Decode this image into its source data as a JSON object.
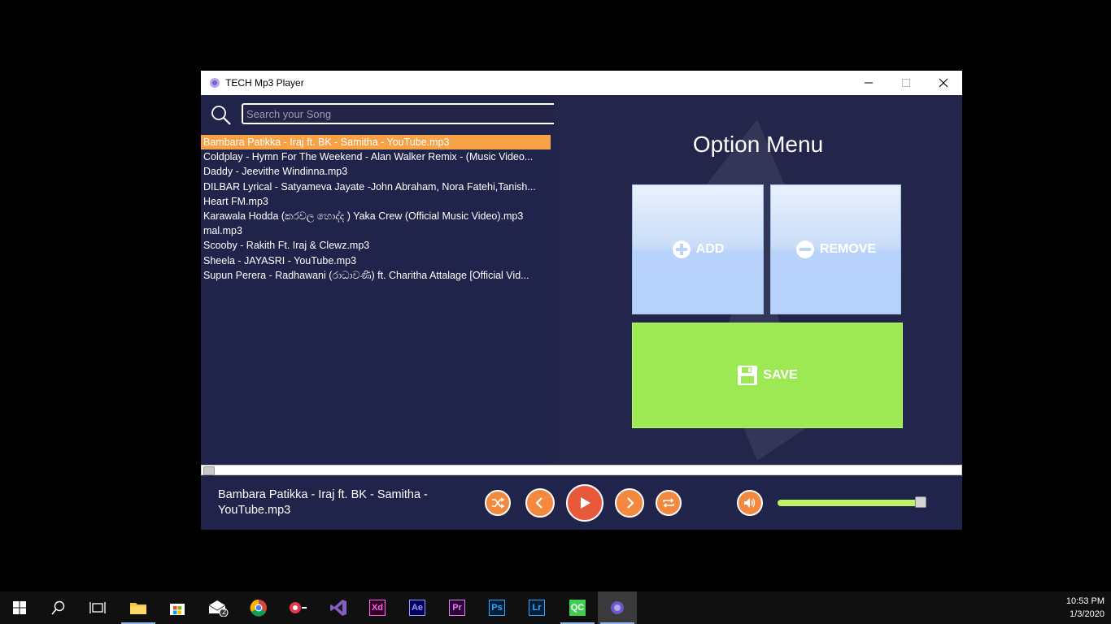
{
  "window": {
    "title": "TECH Mp3 Player"
  },
  "search": {
    "placeholder": "Search your Song"
  },
  "songs": [
    "Bambara Patikka - Iraj ft. BK - Samitha - YouTube.mp3",
    "Coldplay - Hymn For The Weekend - Alan Walker Remix - (Music Video...",
    "Daddy - Jeevithe Windinna.mp3",
    "DILBAR Lyrical - Satyameva Jayate -John Abraham, Nora Fatehi,Tanish...",
    "Heart FM.mp3",
    "Karawala Hodda (කරවල හොද්ද ) Yaka Crew (Official Music Video).mp3",
    "mal.mp3",
    "Scooby - Rakith Ft. Iraj & Clewz.mp3",
    "Sheela - JAYASRI - YouTube.mp3",
    "Supun Perera - Radhawani (රාධාවණී) ft. Charitha Attalage [Official Vid..."
  ],
  "selected_index": 0,
  "option_menu": {
    "title": "Option Menu",
    "add_label": "ADD",
    "remove_label": "REMOVE",
    "save_label": "SAVE"
  },
  "player": {
    "now_playing": "Bambara Patikka - Iraj ft. BK - Samitha - YouTube.mp3",
    "progress": 0.0,
    "volume": 0.98
  },
  "taskbar": {
    "time": "10:53 PM",
    "date": "1/3/2020",
    "mail_badge": "2",
    "apps": [
      "Xd",
      "Ae",
      "Pr",
      "Ps",
      "Lr",
      "QC"
    ]
  },
  "colors": {
    "selected_row": "#f7a247",
    "background": "#20234a",
    "save_tile": "#9ce954",
    "control_orange": "#f3893f",
    "play_red": "#e8583b",
    "volume_fill": "#bff266"
  }
}
